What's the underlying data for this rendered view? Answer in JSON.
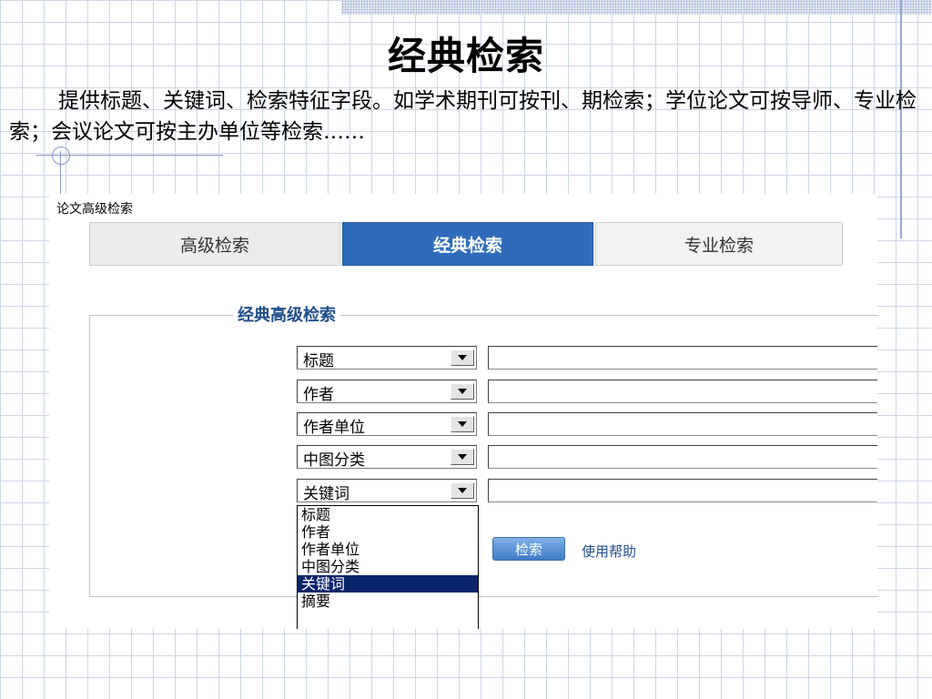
{
  "slide": {
    "title": "经典检索",
    "description": "提供标题、关键词、检索特征字段。如学术期刊可按刊、期检索；学位论文可按导师、专业检索；会议论文可按主办单位等检索……"
  },
  "screenshot": {
    "title": "论文高级检索",
    "tabs": [
      {
        "label": "高级检索",
        "active": false
      },
      {
        "label": "经典检索",
        "active": true
      },
      {
        "label": "专业检索",
        "active": false
      }
    ],
    "legend": "经典高级检索",
    "fields": [
      {
        "selected": "标题",
        "value": ""
      },
      {
        "selected": "作者",
        "value": ""
      },
      {
        "selected": "作者单位",
        "value": ""
      },
      {
        "selected": "中图分类",
        "value": ""
      },
      {
        "selected": "关键词",
        "value": ""
      }
    ],
    "dropdown_options": [
      "标题",
      "作者",
      "作者单位",
      "中图分类",
      "关键词",
      "摘要"
    ],
    "dropdown_highlighted": "关键词",
    "search_button": "检索",
    "help_link": "使用帮助",
    "colors": {
      "active_tab": "#2e6cba",
      "legend": "#1f4e8c",
      "dropdown_highlight": "#0a246a"
    }
  }
}
